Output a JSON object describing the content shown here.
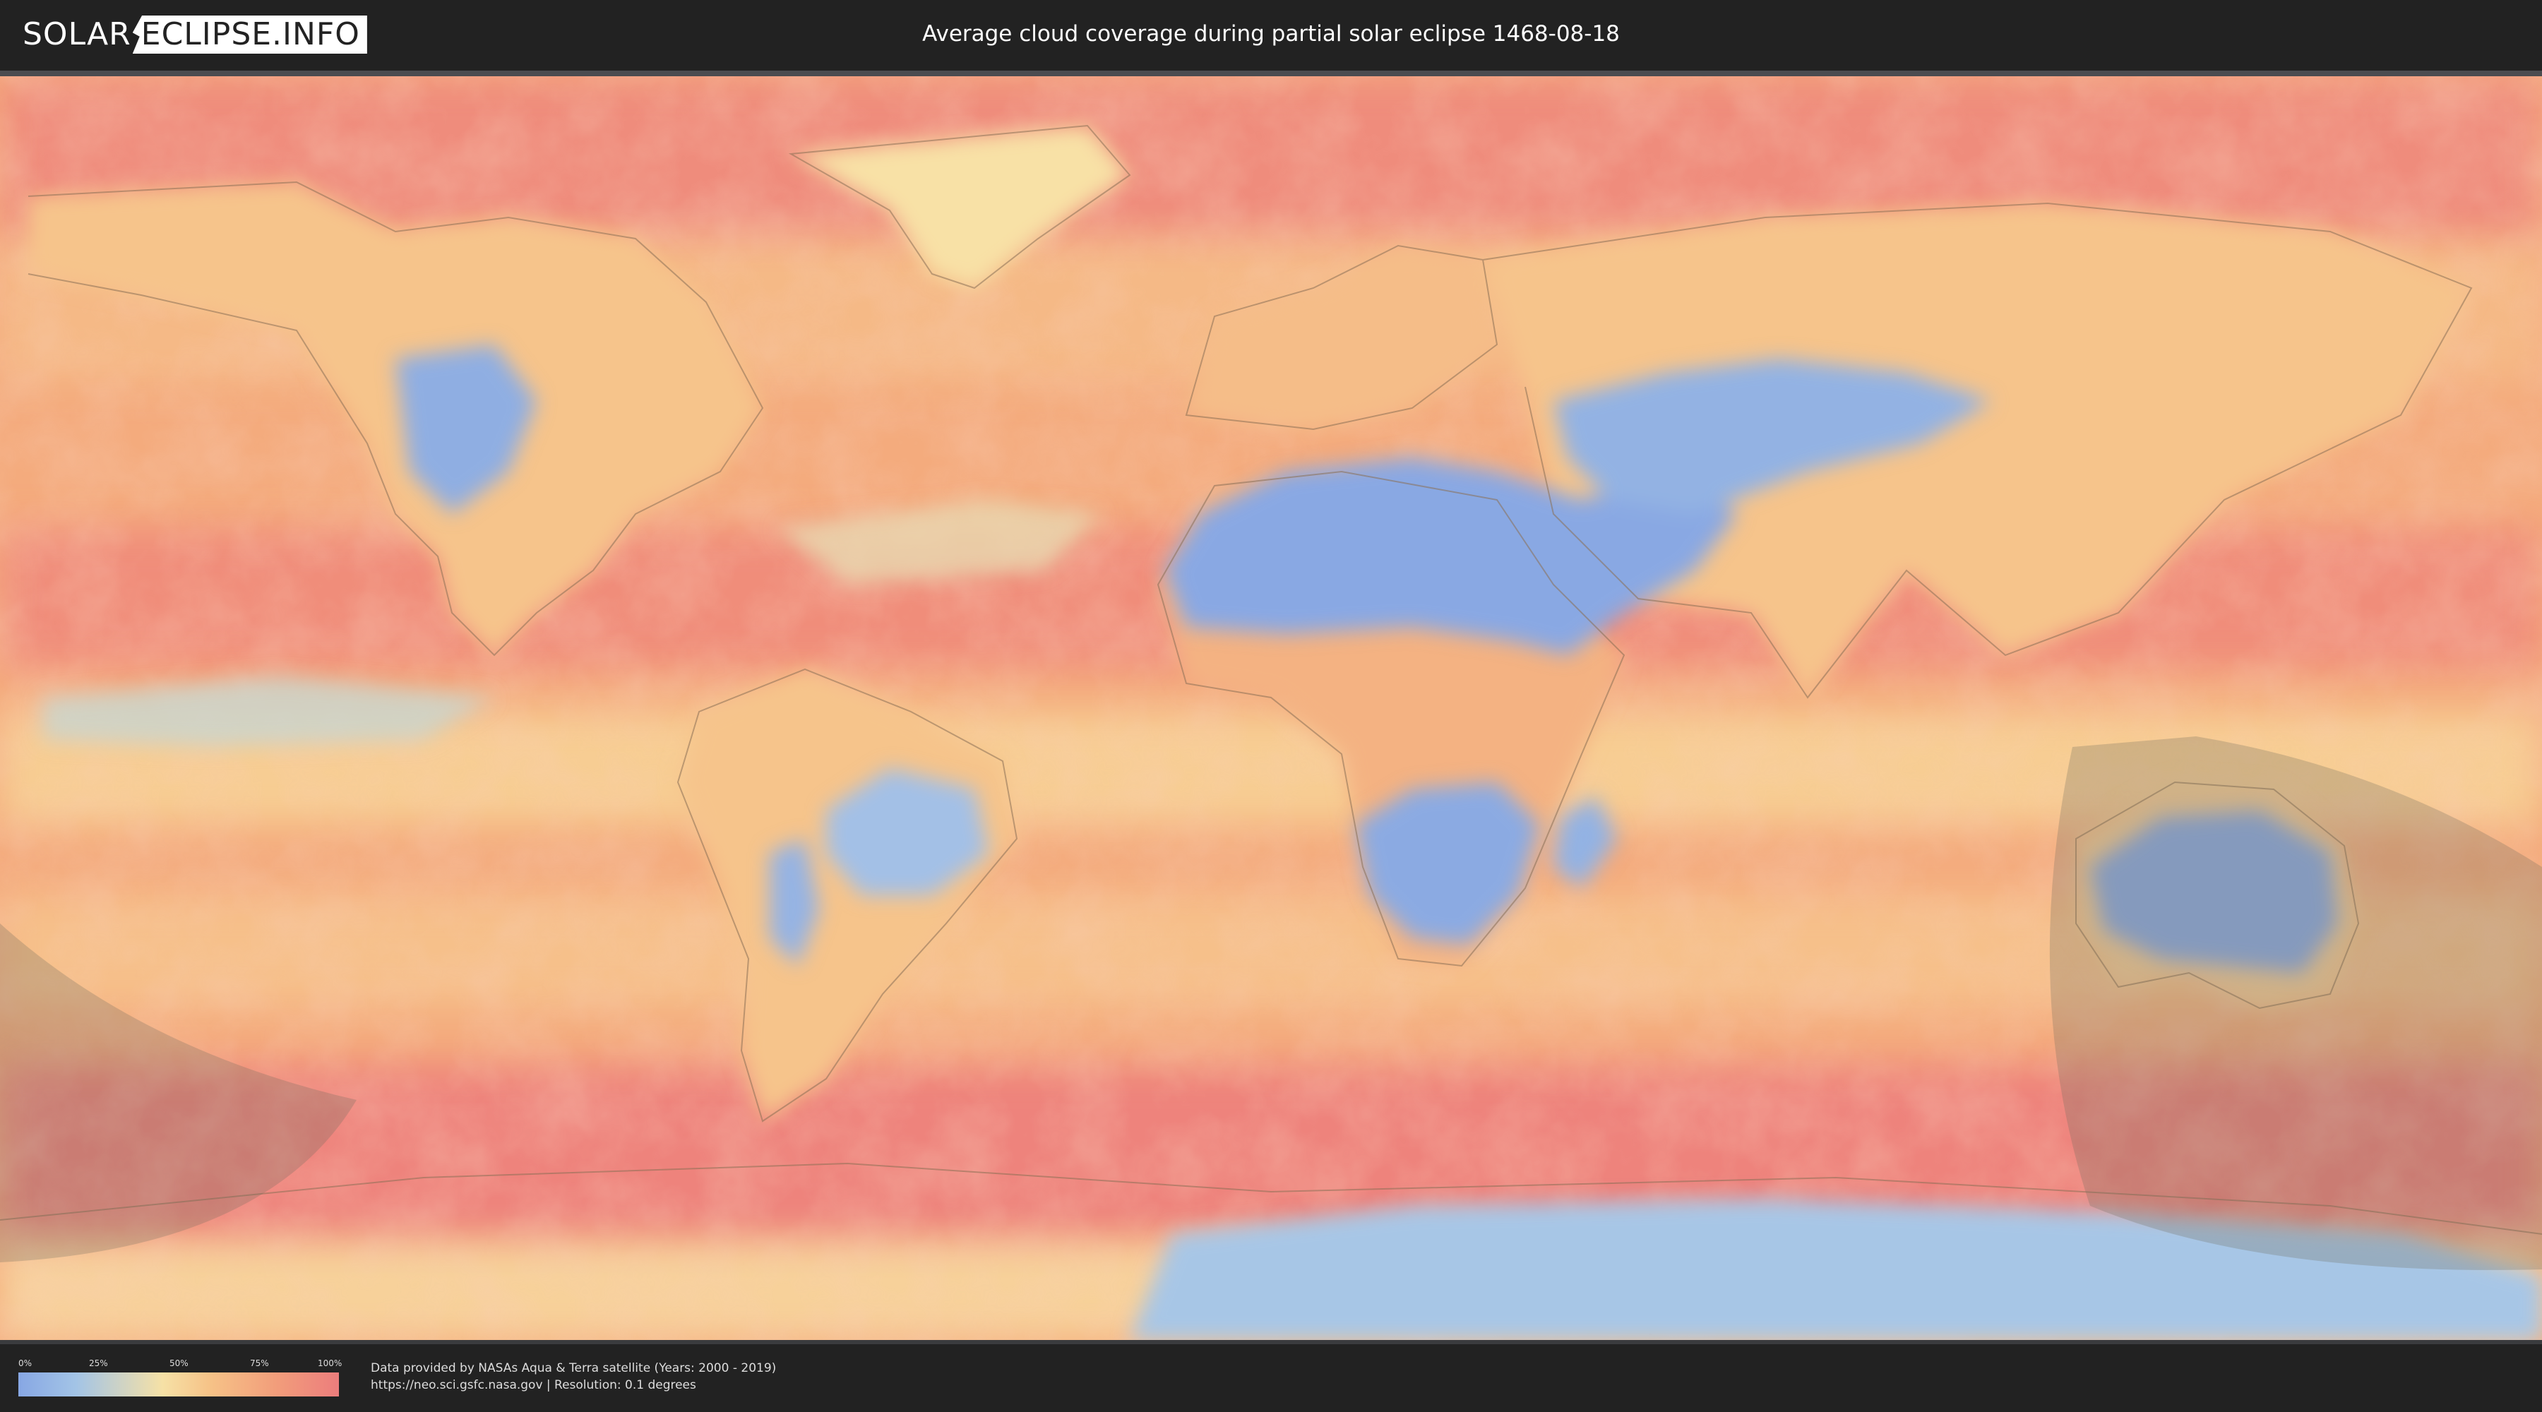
{
  "header": {
    "logo_left": "SOLAR",
    "logo_right": "ECLIPSE.INFO",
    "title": "Average cloud coverage during partial solar eclipse 1468-08-18"
  },
  "map": {
    "kind": "world cloud coverage map (equirectangular)",
    "palette": {
      "clear": "#87a7e4",
      "low": "#a7c6e6",
      "mid": "#f6e1a6",
      "high": "#f6b983",
      "overcast": "#ec7d7c",
      "shadow_overlay": "#6f6a5e",
      "border_lines": "#8a6f55"
    }
  },
  "legend": {
    "ticks": [
      "0%",
      "25%",
      "50%",
      "75%",
      "100%"
    ],
    "colors": [
      "#87a7e4",
      "#a3c4e6",
      "#f6e1a6",
      "#f29e7b",
      "#ec7d7c"
    ]
  },
  "footer": {
    "source_line": "Data provided by NASAs Aqua & Terra satellite (Years: 2000 - 2019)",
    "url_line": "https://neo.sci.gsfc.nasa.gov | Resolution: 0.1 degrees"
  }
}
